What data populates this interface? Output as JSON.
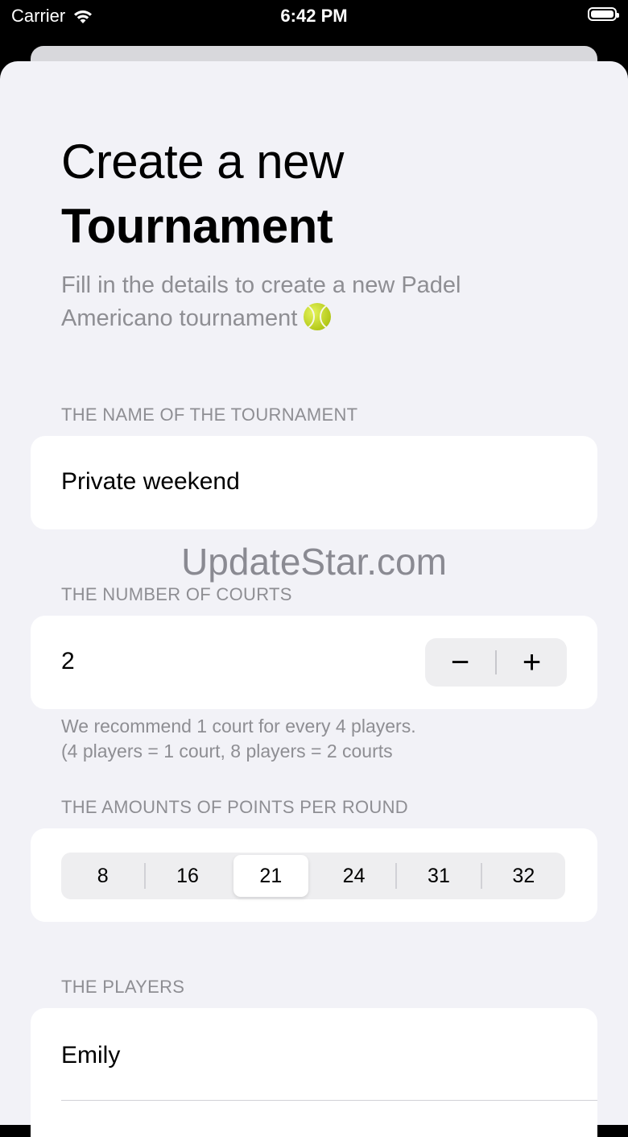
{
  "status_bar": {
    "carrier": "Carrier",
    "time": "6:42 PM"
  },
  "header": {
    "title_line1": "Create a new",
    "title_line2": "Tournament",
    "subtitle": "Fill in the details to create a new Padel Americano tournament"
  },
  "name_section": {
    "label": "THE NAME OF THE TOURNAMENT",
    "value": "Private weekend"
  },
  "watermark": "UpdateStar.com",
  "courts_section": {
    "label": "THE NUMBER OF COURTS",
    "value": "2",
    "decrement": "−",
    "increment": "+",
    "hint_line1": "We recommend 1 court for every 4 players.",
    "hint_line2": "(4 players = 1 court, 8 players = 2 courts"
  },
  "points_section": {
    "label": "THE AMOUNTS OF POINTS PER ROUND",
    "options": [
      "8",
      "16",
      "21",
      "24",
      "31",
      "32"
    ],
    "selected": "21"
  },
  "players_section": {
    "label": "THE PLAYERS",
    "players": [
      "Emily"
    ]
  },
  "colors": {
    "background": "#f2f2f7",
    "card": "#ffffff",
    "secondary_text": "#8e8e93"
  }
}
